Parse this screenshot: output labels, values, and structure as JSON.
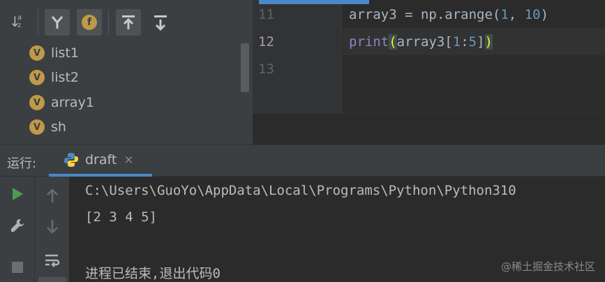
{
  "structure": {
    "items": [
      {
        "badge": "V",
        "label": "list1"
      },
      {
        "badge": "V",
        "label": "list2"
      },
      {
        "badge": "V",
        "label": "array1"
      },
      {
        "badge": "V",
        "label": "sh"
      }
    ],
    "toolbar": {
      "sort_az_label": "a z",
      "show_fields_badge": "f"
    }
  },
  "editor": {
    "lines": [
      {
        "number": "11",
        "code": "array3 = np.arange(1, 10)"
      },
      {
        "number": "12",
        "code": "print(array3[1:5])"
      },
      {
        "number": "13",
        "code": ""
      }
    ],
    "line11": {
      "a": "array3 = np.arange(",
      "n1": "1",
      "b": ", ",
      "n2": "10",
      "c": ")"
    },
    "line12": {
      "fn": "print",
      "po": "(",
      "a": "array3[",
      "n1": "1",
      "colon": ":",
      "n2": "5",
      "b": "]",
      "pc": ")"
    }
  },
  "run": {
    "title": "运行:",
    "tab_label": "draft",
    "tab_close": "×",
    "console": {
      "path": "C:\\Users\\GuoYo\\AppData\\Local\\Programs\\Python\\Python310",
      "output": "[2 3 4 5]",
      "exit_message": "进程已结束,退出代码0"
    }
  },
  "watermark": "@稀土掘金技术社区",
  "colors": {
    "accent": "#4a88c7",
    "run_green": "#499c54",
    "badge": "#c09a4a",
    "number": "#6897bb",
    "builtin": "#8888c6",
    "paren_highlight": "#ffef28"
  }
}
